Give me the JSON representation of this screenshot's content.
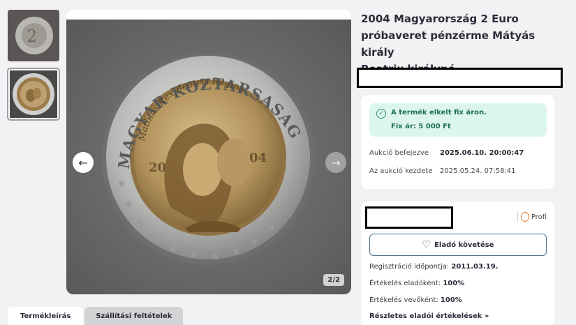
{
  "product": {
    "title_line1": "2004 Magyarország 2 Euro",
    "title_line2": "próbaveret pénzérme Mátyás király",
    "title_line3": "Beatrix királyné"
  },
  "gallery": {
    "counter": "2/2",
    "coin_inscription_top": "MAGYAR KOZTARSASAG",
    "coin_inscription_inner": "Mathias Rex Beatrix Regina",
    "coin_year_left": "20",
    "coin_year_right": "04",
    "prev_icon": "arrow-left-icon",
    "next_icon": "arrow-right-icon"
  },
  "tabs": [
    {
      "label": "Termékleírás"
    },
    {
      "label": "Szállítási feltételek"
    }
  ],
  "auction": {
    "sold_line1": "A termék elkelt fix áron.",
    "sold_line2": "Fix ár: 5 000 Ft",
    "ended_label": "Aukció befejezve",
    "ended_value": "2025.06.10. 20:00:47",
    "started_label": "Az aukció kezdete",
    "started_value": "2025.05.24. 07:58:41"
  },
  "seller": {
    "badge": "Profi",
    "follow_label": "Eladó követése",
    "reg_label": "Regisztráció időpontja:",
    "reg_value": "2011.03.19.",
    "seller_rating_label": "Értékelés eladóként:",
    "seller_rating_value": "100%",
    "buyer_rating_label": "Értékelés vevőként:",
    "buyer_rating_value": "100%",
    "more_label": "Részletes eladói értékelések »"
  },
  "colors": {
    "accent_green": "#dcf6ef",
    "follow_border": "#4a6e88",
    "badge_orange": "#e07c31"
  }
}
